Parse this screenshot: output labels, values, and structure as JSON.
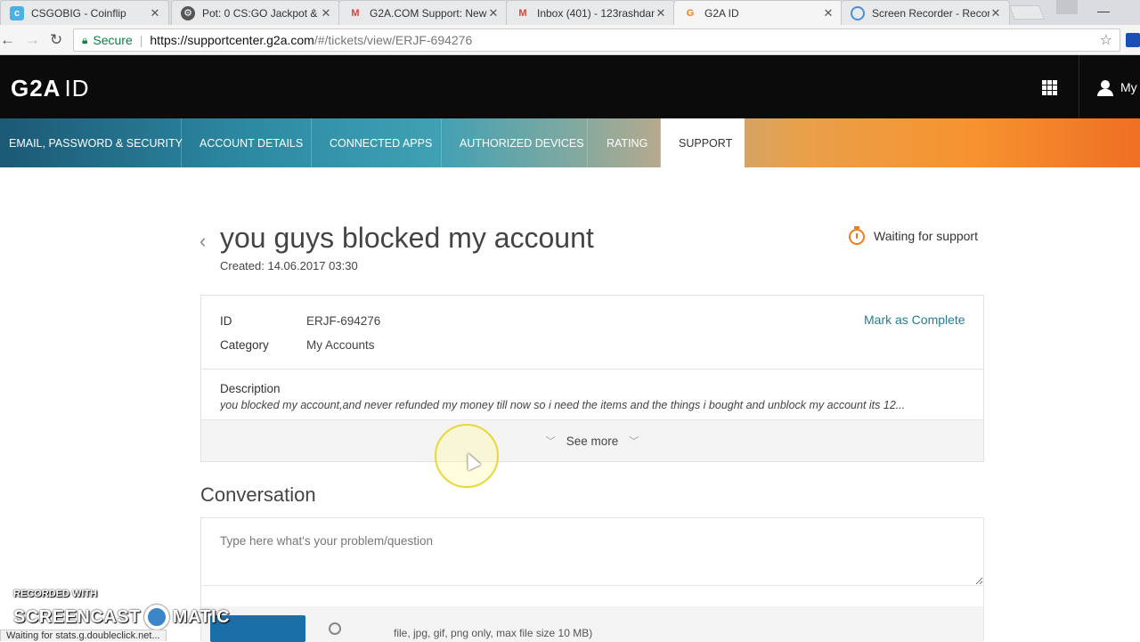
{
  "browser": {
    "tabs": [
      {
        "title": "CSGOBIG - Coinflip",
        "favicon": "csgobig-icon",
        "active": false
      },
      {
        "title": "Pot: 0 CS:GO Jackpot &",
        "favicon": "jackpot-icon",
        "active": false
      },
      {
        "title": "G2A.COM Support: New",
        "favicon": "gmail-icon",
        "active": false
      },
      {
        "title": "Inbox (401) - 123rashdan",
        "favicon": "gmail-icon",
        "active": false
      },
      {
        "title": "G2A ID",
        "favicon": "g2a-icon",
        "active": true
      },
      {
        "title": "Screen Recorder - Recor",
        "favicon": "recorder-icon",
        "active": false
      }
    ],
    "secure_label": "Secure",
    "url_host": "https://supportcenter.g2a.com",
    "url_path": "/#/tickets/view/ERJF-694276",
    "status_text": "Waiting for stats.g.doubleclick.net..."
  },
  "header": {
    "logo_text": "G2A",
    "logo_suffix": "ID",
    "user_label": "My"
  },
  "nav": {
    "items": [
      {
        "label": "EMAIL, PASSWORD & SECURITY",
        "active": false
      },
      {
        "label": "ACCOUNT DETAILS",
        "active": false
      },
      {
        "label": "CONNECTED APPS",
        "active": false
      },
      {
        "label": "AUTHORIZED DEVICES",
        "active": false
      },
      {
        "label": "RATING",
        "active": false
      },
      {
        "label": "SUPPORT",
        "active": true
      }
    ]
  },
  "ticket": {
    "title": "you guys blocked my account",
    "created": "Created: 14.06.2017 03:30",
    "status": "Waiting for support",
    "id_label": "ID",
    "id_value": "ERJF-694276",
    "category_label": "Category",
    "category_value": "My Accounts",
    "mark_complete": "Mark as Complete",
    "description_label": "Description",
    "description_text": "you blocked my account,and never refunded my money till now so i need the items and the things i bought and unblock my account its 12...",
    "see_more": "See more"
  },
  "conversation": {
    "title": "Conversation",
    "placeholder": "Type here what's your problem/question",
    "file_hint": "file, jpg, gif, png only, max file size 10 MB)"
  },
  "watermark": {
    "small": "RECORDED WITH",
    "big_left": "SCREENCAST",
    "big_right": "MATIC"
  },
  "colors": {
    "accent_link": "#1f7f93",
    "status_orange": "#f07d1c",
    "header_bg": "#0b0b0b"
  }
}
